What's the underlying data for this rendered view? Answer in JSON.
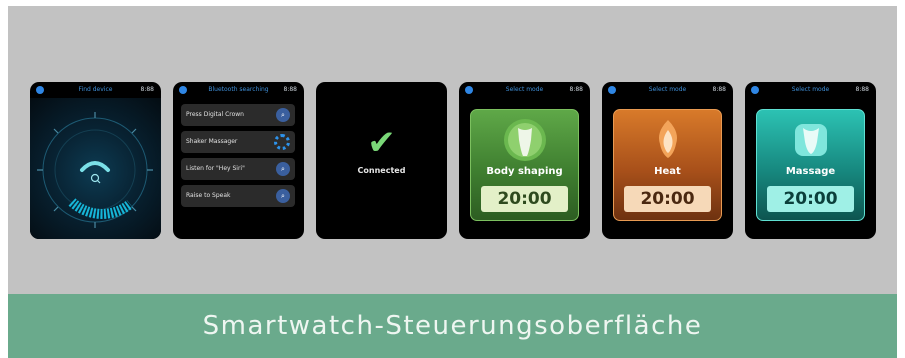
{
  "watches": {
    "find": {
      "title": "Find device",
      "time": "8:88"
    },
    "bluetooth": {
      "title": "Bluetooth searching",
      "time": "8:88",
      "rows": [
        {
          "label": "Press Digital Crown",
          "icon": "search-icon"
        },
        {
          "label": "Shaker Massager",
          "icon": "loading-spinner-icon"
        },
        {
          "label": "Listen for \"Hey Siri\"",
          "icon": "search-icon"
        },
        {
          "label": "Raise to Speak",
          "icon": "search-icon"
        }
      ]
    },
    "connected": {
      "label": "Connected",
      "icon": "checkmark-icon",
      "accent": "#7ad878"
    },
    "body_shaping": {
      "title": "Select mode",
      "time": "8:88",
      "mode": "Body shaping",
      "duration": "20:00",
      "color": "#4f9a3a"
    },
    "heat": {
      "title": "Select mode",
      "time": "8:88",
      "mode": "Heat",
      "duration": "20:00",
      "color": "#c8641e"
    },
    "massage": {
      "title": "Select mode",
      "time": "8:88",
      "mode": "Massage",
      "duration": "20:00",
      "color": "#1fb3a8"
    }
  },
  "banner": {
    "text": "Smartwatch-Steuerungsoberfläche",
    "color": "#6aaa8c"
  }
}
